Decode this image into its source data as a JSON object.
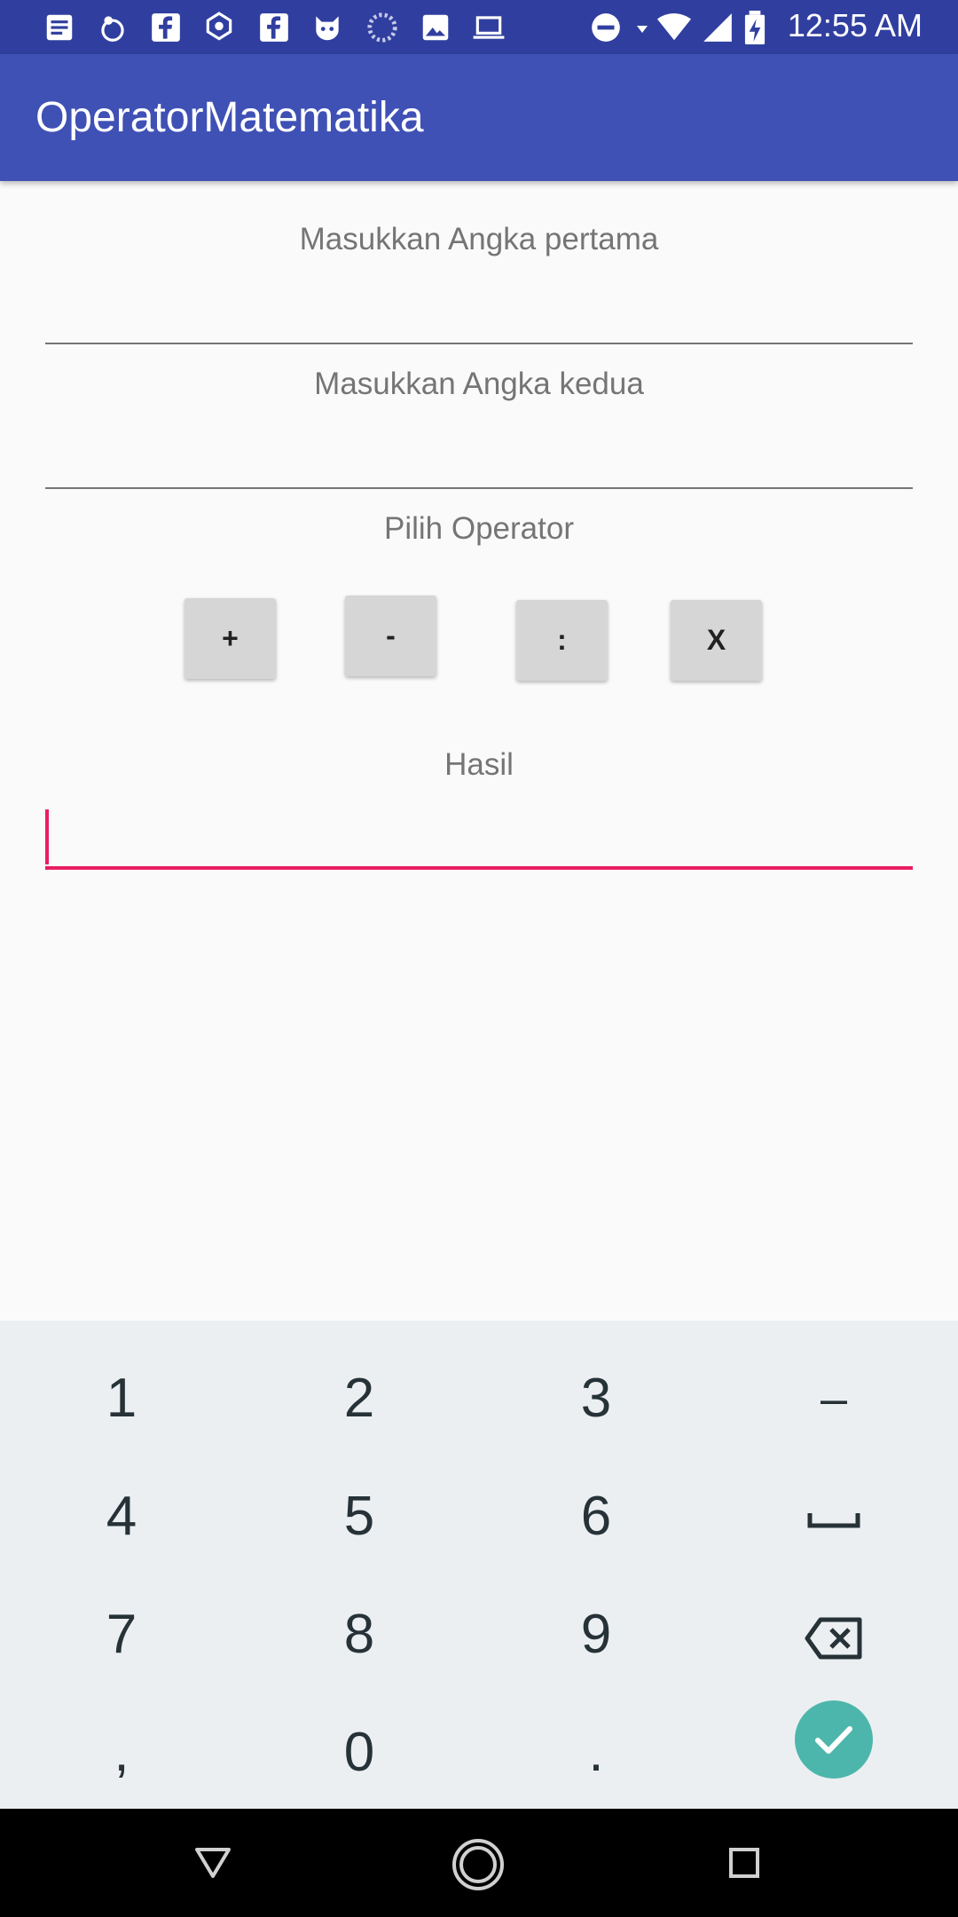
{
  "status_bar": {
    "time": "12:55 AM",
    "icons": [
      "notification-icon",
      "uc-browser-icon",
      "facebook-icon",
      "tricolor-logo-icon",
      "facebook-icon",
      "cat-icon",
      "loading-icon",
      "image-icon",
      "laptop-icon",
      "do-not-disturb-icon",
      "wifi-icon",
      "signal-icon",
      "battery-charging-icon"
    ]
  },
  "app_bar": {
    "title": "OperatorMatematika"
  },
  "form": {
    "first_label": "Masukkan Angka pertama",
    "second_label": "Masukkan Angka kedua",
    "operator_label": "Pilih Operator",
    "operators": [
      "+",
      "-",
      ":",
      "X"
    ],
    "result_label": "Hasil",
    "first_value": "",
    "second_value": "",
    "result_value": ""
  },
  "keyboard": {
    "rows": [
      [
        "1",
        "2",
        "3",
        "–"
      ],
      [
        "4",
        "5",
        "6",
        "space"
      ],
      [
        "7",
        "8",
        "9",
        "backspace"
      ],
      [
        ",",
        "0",
        ".",
        "done"
      ]
    ]
  },
  "colors": {
    "primary": "#3f51b5",
    "primary_dark": "#303f9f",
    "accent": "#e91e63",
    "keyboard_bg": "#eceff1",
    "done_button": "#4db6ac"
  }
}
